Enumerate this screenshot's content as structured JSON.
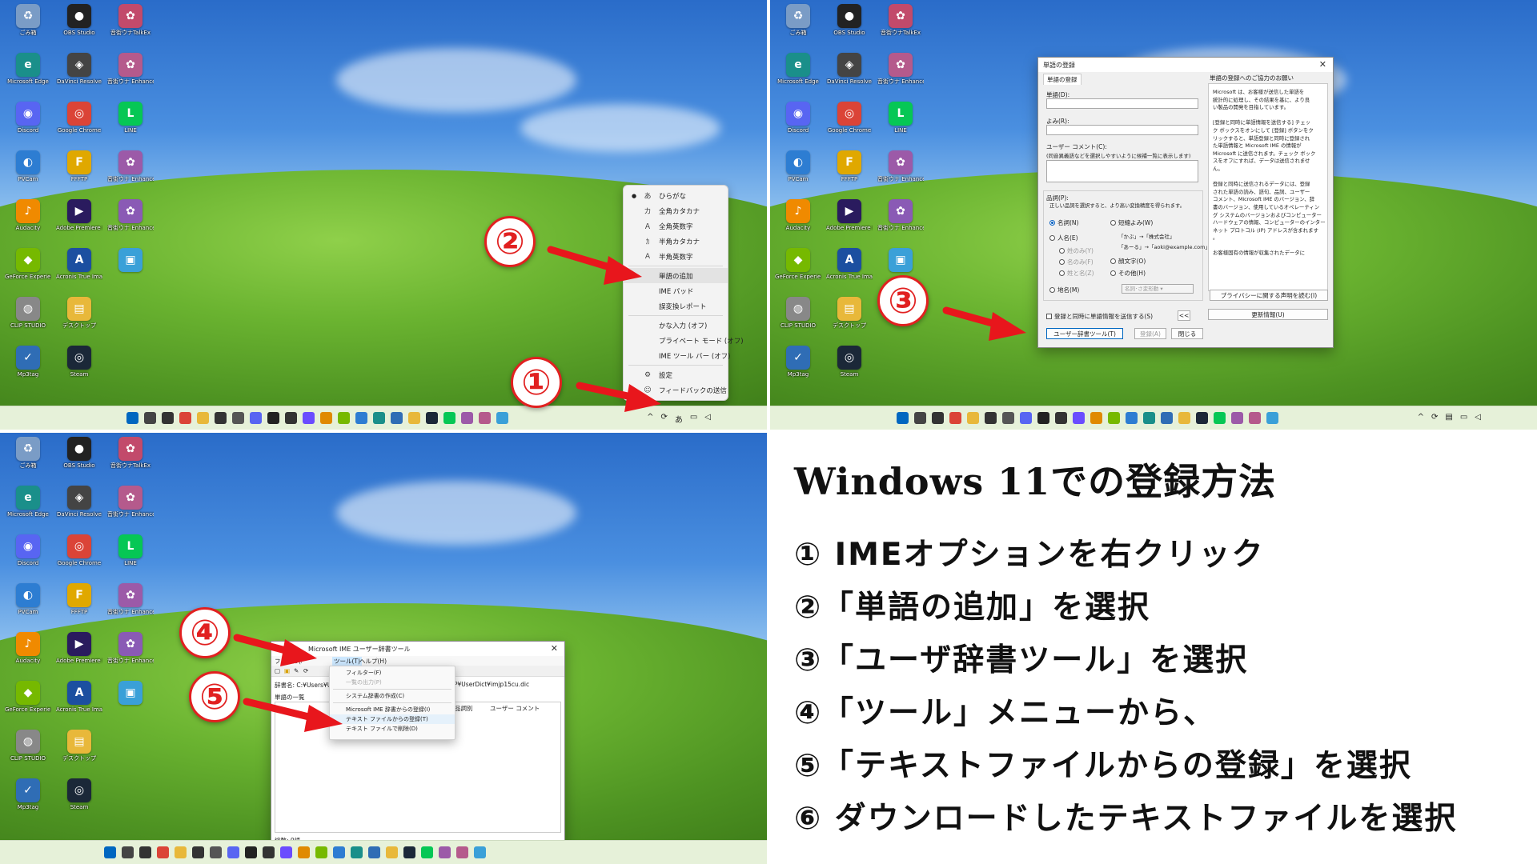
{
  "desktop_icons": [
    {
      "label": "ごみ箱",
      "color": "#7a9cc6",
      "glyph": "♻"
    },
    {
      "label": "OBS Studio",
      "color": "#222222",
      "glyph": "●"
    },
    {
      "label": "音街ウナTalkEx",
      "color": "#c24a6b",
      "glyph": "✿"
    },
    {
      "label": "Microsoft Edge",
      "color": "#1a8f8a",
      "glyph": "e"
    },
    {
      "label": "DaVinci Resolve",
      "color": "#444444",
      "glyph": "◈"
    },
    {
      "label": "音街ウナ Enhanced Edit",
      "color": "#b55a8c",
      "glyph": "✿"
    },
    {
      "label": "Discord",
      "color": "#5865f2",
      "glyph": "◉"
    },
    {
      "label": "Google Chrome",
      "color": "#db4437",
      "glyph": "◎"
    },
    {
      "label": "LINE",
      "color": "#06c755",
      "glyph": "L"
    },
    {
      "label": "PVCam",
      "color": "#2d7dd2",
      "glyph": "◐"
    },
    {
      "label": "FFFTP",
      "color": "#e0a800",
      "glyph": "F"
    },
    {
      "label": "音街ウナ Enhanced Edit",
      "color": "#9c5aa8",
      "glyph": "✿"
    },
    {
      "label": "Audacity",
      "color": "#f08a00",
      "glyph": "♪"
    },
    {
      "label": "Adobe Premiere Elements",
      "color": "#2a1b5e",
      "glyph": "▶"
    },
    {
      "label": "音街ウナ Enhanced Edit",
      "color": "#8a5ab5",
      "glyph": "✿"
    },
    {
      "label": "GeForce Experience",
      "color": "#76b900",
      "glyph": "◆"
    },
    {
      "label": "Acronis True Image",
      "color": "#1c4fa0",
      "glyph": "A"
    },
    {
      "label": "",
      "color": "#3aa0d8",
      "glyph": "▣"
    },
    {
      "label": "CLIP STUDIO",
      "color": "#888888",
      "glyph": "◍"
    },
    {
      "label": "デスクトップ",
      "color": "#e8b83a",
      "glyph": "▤"
    },
    {
      "label": "",
      "color": "transparent",
      "glyph": ""
    },
    {
      "label": "Mp3tag",
      "color": "#2f6db5",
      "glyph": "✓"
    },
    {
      "label": "Steam",
      "color": "#1b2838",
      "glyph": "◎"
    }
  ],
  "ime_menu": {
    "items": [
      {
        "icon": "あ",
        "label": "ひらがな",
        "checked": true
      },
      {
        "icon": "カ",
        "label": "全角カタカナ",
        "checked": false
      },
      {
        "icon": "Ａ",
        "label": "全角英数字",
        "checked": false
      },
      {
        "icon": "ｶ",
        "label": "半角カタカナ",
        "checked": false
      },
      {
        "icon": "A",
        "label": "半角英数字",
        "checked": false
      }
    ],
    "group2": [
      "単語の追加",
      "IME パッド",
      "誤変換レポート"
    ],
    "group3": [
      "かな入力 (オフ)",
      "プライベート モード (オフ)",
      "IME ツール バー (オフ)"
    ],
    "group4": [
      {
        "icon": "⚙",
        "label": "設定"
      },
      {
        "icon": "☺",
        "label": "フィードバックの送信"
      }
    ]
  },
  "tray_ime_char": "あ",
  "word_dialog": {
    "title": "単語の登録",
    "tab": "単語の登録",
    "word_label": "単語(D):",
    "reading_label": "よみ(R):",
    "comment_label": "ユーザー コメント(C):",
    "comment_hint": "(同音異義語などを選択しやすいように候補一覧に表示します)",
    "pos_label": "品詞(P):",
    "pos_hint": "正しい品詞を選択すると、より高い変換精度を得られます。",
    "pos_noun": "名詞(N)",
    "pos_dakumi": "短縮よみ(W)",
    "pos_person": "人名(E)",
    "pos_person_sub1": "姓のみ(Y)",
    "pos_person_sub2": "名のみ(F)",
    "pos_person_sub3": "姓と名(Z)",
    "pos_example1": "「かぶ」→「株式会社」",
    "pos_example2": "「あーる」→「aoki@example.com」",
    "pos_sentence": "顔文字(O)",
    "pos_other": "その他(H)",
    "pos_place": "地名(M)",
    "pos_select": "名詞･さ変形動",
    "send_checkbox": "登録と同時に単語情報を送信する(S)",
    "collapse": "<<",
    "info_title": "単語の登録へのご協力のお願い",
    "info_text": [
      "Microsoft は、お客様が送信した単語を",
      "統計的に処理し、その結果を基に、より良",
      "い製品の開発を目指しています。",
      "",
      "[登録と同時に単語情報を送信する] チェッ",
      "ク ボックスをオンにして [登録] ボタンをク",
      "リックすると、単語登録と同時に登録され",
      "た単語情報と Microsoft IME の情報が",
      "Microsoft に送信されます。チェック ボック",
      "スをオフにすれば、データは送信されませ",
      "ん。",
      "",
      "登録と同時に送信されるデータには、登録",
      "された単語の読み、語句、品詞、ユーザー",
      "コメント、Microsoft IME のバージョン、辞",
      "書のバージョン、使用しているオペレーティン",
      "グ システムのバージョンおよびコンピューター",
      "ハードウェアの情報、コンピューターのインター",
      "ネット プロトコル (IP) アドレスが含まれます",
      "。",
      "",
      "お客様固有の情報が収集されたデータに"
    ],
    "privacy_button": "プライバシーに関する声明を読む(I)",
    "update_button": "更新情報(U)",
    "user_dict_button": "ユーザー辞書ツール(T)",
    "register_button": "登録(A)",
    "close_button": "閉じる"
  },
  "dict_tool": {
    "title": "Microsoft IME ユーザー辞書ツール",
    "menu_file": "ファイル(F)",
    "menu_edit": "編集(E)",
    "menu_tool": "ツール(T)",
    "menu_help": "ヘルプ(H)",
    "path_label": "辞書名: C:¥Users¥USE",
    "path_tail": "P¥UserDict¥imjp15cu.dic",
    "list_title": "単語の一覧",
    "col_pos": "品詞別",
    "col_comment": "ユーザー コメント",
    "status": "総数: 0語",
    "tool_menu": [
      "フィルター(F)",
      "一覧の出力(P)",
      "システム辞書の作成(C)",
      "Microsoft IME 辞書からの登録(I)",
      "テキスト ファイルからの登録(T)",
      "テキスト ファイルで削除(D)"
    ],
    "tool_menu_disabled": [
      false,
      true,
      false,
      false,
      false,
      false
    ]
  },
  "badges": [
    "②",
    "①",
    "③",
    "④",
    "⑤"
  ],
  "instructions": {
    "title": "Windows 11での登録方法",
    "steps": [
      "① IMEオプションを右クリック",
      "②「単語の追加」を選択",
      "③「ユーザ辞書ツール」を選択",
      "④「ツール」メニューから、",
      "⑤「テキストファイルからの登録」を選択",
      "⑥ ダウンロードしたテキストファイルを選択"
    ]
  },
  "colors": {
    "arrow": "#e8161c",
    "badge": "#e12020",
    "taskbar": "#e6f1d9"
  }
}
